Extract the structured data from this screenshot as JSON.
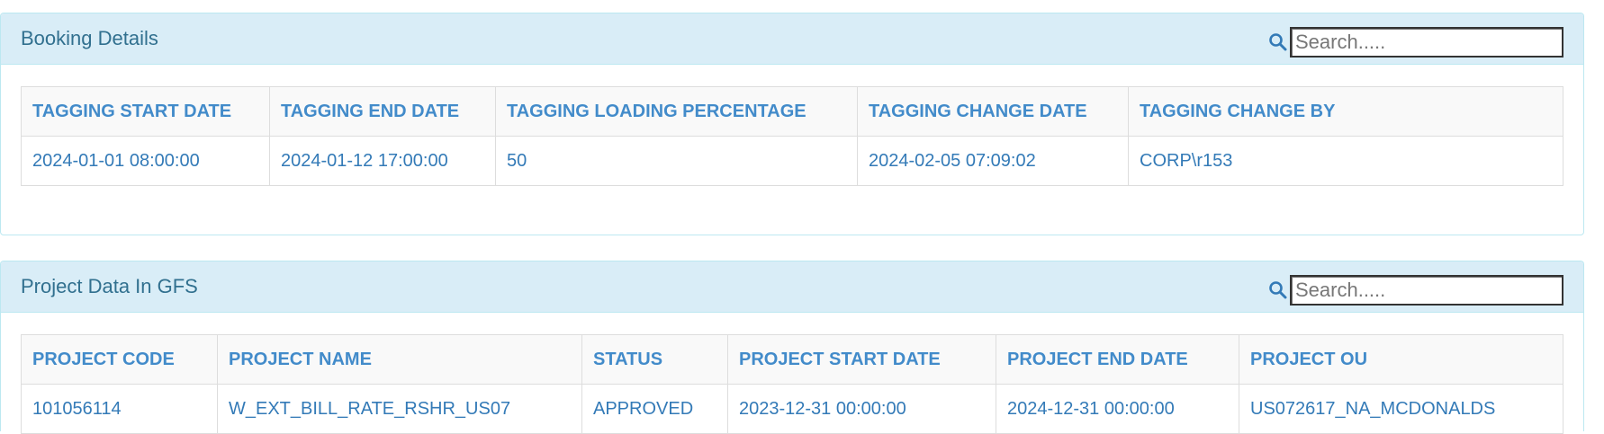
{
  "booking": {
    "title": "Booking Details",
    "search_placeholder": "Search.....",
    "columns": [
      "TAGGING START DATE",
      "TAGGING END DATE",
      "TAGGING LOADING PERCENTAGE",
      "TAGGING CHANGE DATE",
      "TAGGING CHANGE BY"
    ],
    "rows": [
      [
        "2024-01-01 08:00:00",
        "2024-01-12 17:00:00",
        "50",
        "2024-02-05 07:09:02",
        "CORP\\r153"
      ]
    ]
  },
  "project": {
    "title": "Project Data In GFS",
    "search_placeholder": "Search.....",
    "columns": [
      "PROJECT CODE",
      "PROJECT NAME",
      "STATUS",
      "PROJECT START DATE",
      "PROJECT END DATE",
      "PROJECT OU"
    ],
    "rows": [
      [
        "101056114",
        "W_EXT_BILL_RATE_RSHR_US07",
        "APPROVED",
        "2023-12-31 00:00:00",
        "2024-12-31 00:00:00",
        "US072617_NA_MCDONALDS"
      ]
    ]
  },
  "colors": {
    "heading_bg": "#d9edf7",
    "heading_border": "#bce8f1",
    "title_text": "#31708f",
    "link_text": "#337ab7"
  },
  "icons": {
    "search": "search-icon"
  }
}
